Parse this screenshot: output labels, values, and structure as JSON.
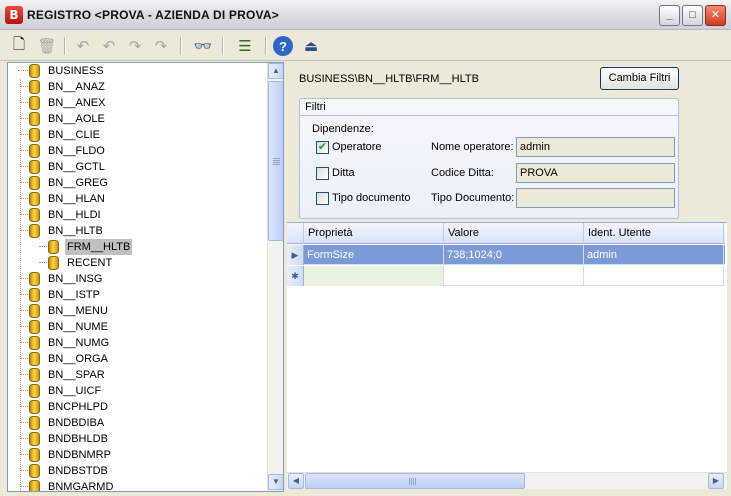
{
  "window": {
    "title": "REGISTRO <PROVA - AZIENDA DI PROVA>",
    "app_icon_letter": "B",
    "controls": {
      "minimize": "_",
      "maximize": "□",
      "close": "✕"
    }
  },
  "toolbar": {
    "buttons": [
      {
        "name": "new-document-icon",
        "glyph": "🗋",
        "enabled": true
      },
      {
        "name": "trash-icon",
        "glyph": "🗑",
        "enabled": false
      },
      {
        "name": "undo-icon",
        "glyph": "↶",
        "enabled": false
      },
      {
        "name": "undo-all-icon",
        "glyph": "↶",
        "enabled": false
      },
      {
        "name": "redo-icon",
        "glyph": "↷",
        "enabled": false
      },
      {
        "name": "cancel-edit-icon",
        "glyph": "↷",
        "enabled": false
      },
      {
        "name": "binoculars-icon",
        "glyph": "👓",
        "enabled": true
      },
      {
        "name": "list-view-icon",
        "glyph": "☰",
        "enabled": true
      },
      {
        "name": "help-icon",
        "glyph": "?",
        "enabled": true
      },
      {
        "name": "exit-door-icon",
        "glyph": "⏏",
        "enabled": true
      }
    ]
  },
  "tree": {
    "root": "BUSINESS",
    "items": [
      {
        "label": "BN__ANAZ",
        "level": 1
      },
      {
        "label": "BN__ANEX",
        "level": 1
      },
      {
        "label": "BN__AOLE",
        "level": 1
      },
      {
        "label": "BN__CLIE",
        "level": 1
      },
      {
        "label": "BN__FLDO",
        "level": 1
      },
      {
        "label": "BN__GCTL",
        "level": 1
      },
      {
        "label": "BN__GREG",
        "level": 1
      },
      {
        "label": "BN__HLAN",
        "level": 1
      },
      {
        "label": "BN__HLDI",
        "level": 1
      },
      {
        "label": "BN__HLTB",
        "level": 1
      },
      {
        "label": "FRM__HLTB",
        "level": 2,
        "selected": true
      },
      {
        "label": "RECENT",
        "level": 2
      },
      {
        "label": "BN__INSG",
        "level": 1
      },
      {
        "label": "BN__ISTP",
        "level": 1
      },
      {
        "label": "BN__MENU",
        "level": 1
      },
      {
        "label": "BN__NUME",
        "level": 1
      },
      {
        "label": "BN__NUMG",
        "level": 1
      },
      {
        "label": "BN__ORGA",
        "level": 1
      },
      {
        "label": "BN__SPAR",
        "level": 1
      },
      {
        "label": "BN__UICF",
        "level": 1
      },
      {
        "label": "BNCPHLPD",
        "level": 1
      },
      {
        "label": "BNDBDIBA",
        "level": 1
      },
      {
        "label": "BNDBHLDB",
        "level": 1
      },
      {
        "label": "BNDBNMRP",
        "level": 1
      },
      {
        "label": "BNDBSTDB",
        "level": 1
      },
      {
        "label": "BNMGARMD",
        "level": 1
      }
    ]
  },
  "details": {
    "path": "BUSINESS\\BN__HLTB\\FRM__HLTB",
    "cambia_filtri_label": "Cambia Filtri",
    "filters": {
      "title": "Filtri",
      "dependencies_label": "Dipendenze:",
      "operatore": {
        "label": "Operatore",
        "checked": true
      },
      "ditta": {
        "label": "Ditta",
        "checked": false
      },
      "tipo_documento": {
        "label": "Tipo documento",
        "checked": false
      },
      "nome_operatore_label": "Nome operatore:",
      "nome_operatore_value": "admin",
      "codice_ditta_label": "Codice Ditta:",
      "codice_ditta_value": "PROVA",
      "tipo_documento_label": "Tipo Documento:",
      "tipo_documento_value": ""
    }
  },
  "grid": {
    "columns": [
      "Proprietà",
      "Valore",
      "Ident. Utente"
    ],
    "rows": [
      {
        "indicator": "▶",
        "cells": [
          "FormSize",
          "738;1024;0",
          "admin"
        ]
      }
    ],
    "new_row_indicator": "✱"
  },
  "colors": {
    "selection_row": "#7a9bd8",
    "title_accent": "#d2391c",
    "tree_icon": "#ffd54a"
  }
}
